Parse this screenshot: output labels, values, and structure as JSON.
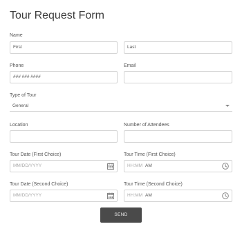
{
  "form": {
    "title": "Tour Request Form",
    "name_label": "Name",
    "first_value": "First",
    "last_value": "Last",
    "phone_label": "Phone",
    "phone_value": "### ### ####",
    "email_label": "Email",
    "email_value": "",
    "type_label": "Type of Tour",
    "type_value": "General",
    "location_label": "Location",
    "location_value": "",
    "attendees_label": "Number of Attendees",
    "attendees_value": "",
    "date1_label": "Tour Date (First Choice)",
    "date1_placeholder": "MM/DD/YYYY",
    "time1_label": "Tour Time (First Choice)",
    "time1_placeholder": "HH:MM",
    "time1_ampm": "AM",
    "date2_label": "Tour Date (Second Choice)",
    "date2_placeholder": "MM/DD/YYYY",
    "time2_label": "Tour Time (Second Choice)",
    "time2_placeholder": "HH:MM",
    "time2_ampm": "AM",
    "send_label": "SEND"
  }
}
